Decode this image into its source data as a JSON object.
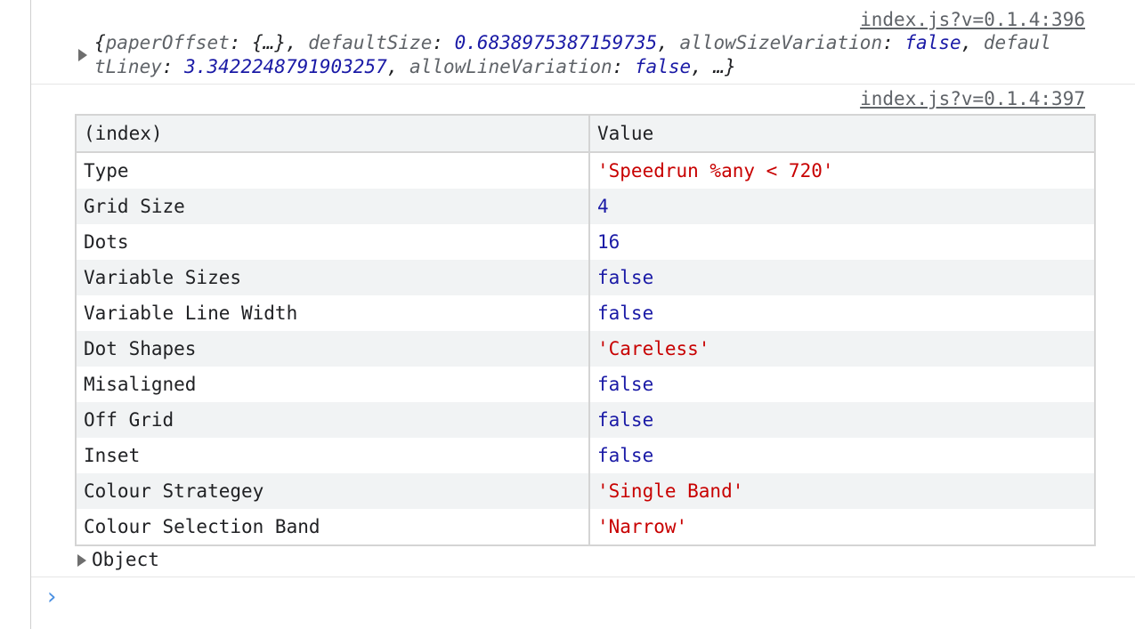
{
  "messages": [
    {
      "source": "index.js?v=0.1.4:396",
      "preview": {
        "line1": [
          {
            "k": "paperOffset",
            "v": "{…}",
            "t": "p"
          },
          {
            "k": "defaultSize",
            "v": "0.6838975387159735",
            "t": "n"
          },
          {
            "k": "allowSizeVariation",
            "v": "false",
            "t": "n"
          }
        ],
        "wrap_key_start": "defaul",
        "wrap_key_end": "tLiney",
        "line2": [
          {
            "k": "defaultLiney",
            "v": "3.3422248791903257",
            "t": "n"
          },
          {
            "k": "allowLineVariation",
            "v": "false",
            "t": "n"
          }
        ],
        "ellipsis": "…"
      }
    },
    {
      "source": "index.js?v=0.1.4:397",
      "table": {
        "headers": [
          "(index)",
          "Value"
        ],
        "rows": [
          {
            "index": "Type",
            "value": "'Speedrun %any < 720'",
            "type": "string"
          },
          {
            "index": "Grid Size",
            "value": "4",
            "type": "number"
          },
          {
            "index": "Dots",
            "value": "16",
            "type": "number"
          },
          {
            "index": "Variable Sizes",
            "value": "false",
            "type": "boolean"
          },
          {
            "index": "Variable Line Width",
            "value": "false",
            "type": "boolean"
          },
          {
            "index": "Dot Shapes",
            "value": "'Careless'",
            "type": "string"
          },
          {
            "index": "Misaligned",
            "value": "false",
            "type": "boolean"
          },
          {
            "index": "Off Grid",
            "value": "false",
            "type": "boolean"
          },
          {
            "index": "Inset",
            "value": "false",
            "type": "boolean"
          },
          {
            "index": "Colour Strategey",
            "value": "'Single Band'",
            "type": "string"
          },
          {
            "index": "Colour Selection Band",
            "value": "'Narrow'",
            "type": "string"
          }
        ]
      },
      "object_label": "Object"
    }
  ],
  "prompt_glyph": "›",
  "colors": {
    "string": "#c80000",
    "number": "#1a1aa6",
    "key": "#5f6368",
    "link": "#5f6368",
    "prompt": "#4a90e2",
    "header_bg": "#f1f3f4"
  }
}
